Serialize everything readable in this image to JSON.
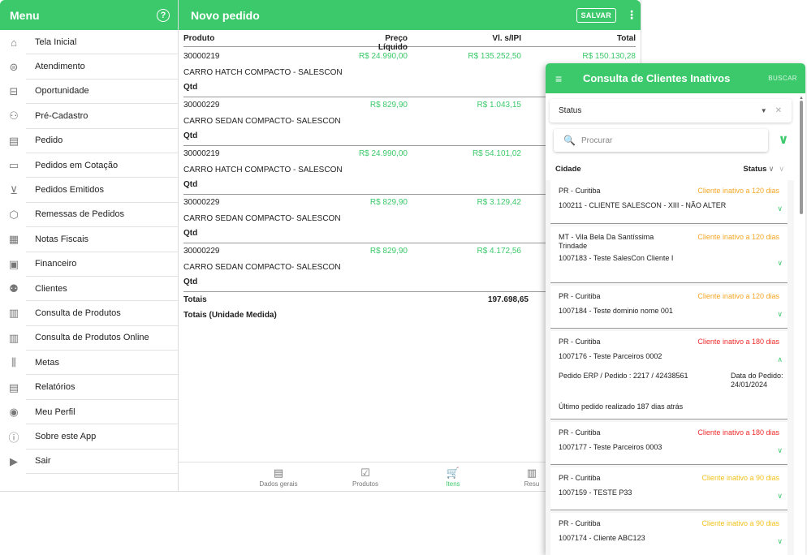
{
  "menu": {
    "title": "Menu",
    "help_icon": "?",
    "items": [
      {
        "label": "Tela Inicial",
        "icon": "⌂",
        "icon_name": "home-icon",
        "slug": "tela-inicial"
      },
      {
        "label": "Atendimento",
        "icon": "⊜",
        "icon_name": "chat-icon",
        "slug": "atendimento"
      },
      {
        "label": "Oportunidade",
        "icon": "⊟",
        "icon_name": "briefcase-icon",
        "slug": "oportunidade"
      },
      {
        "label": "Pré-Cadastro",
        "icon": "⚇",
        "icon_name": "add-user-icon",
        "slug": "pre-cadastro"
      },
      {
        "label": "Pedido",
        "icon": "▤",
        "icon_name": "document-icon",
        "slug": "pedido"
      },
      {
        "label": "Pedidos em Cotação",
        "icon": "▭",
        "icon_name": "quote-icon",
        "slug": "pedidos-em-cotacao"
      },
      {
        "label": "Pedidos Emitidos",
        "icon": "⊻",
        "icon_name": "inbox-icon",
        "slug": "pedidos-emitidos"
      },
      {
        "label": "Remessas de Pedidos",
        "icon": "⬡",
        "icon_name": "box-icon",
        "slug": "remessas-de-pedidos"
      },
      {
        "label": "Notas Fiscais",
        "icon": "▦",
        "icon_name": "invoice-icon",
        "slug": "notas-fiscais"
      },
      {
        "label": "Financeiro",
        "icon": "▣",
        "icon_name": "money-icon",
        "slug": "financeiro"
      },
      {
        "label": "Clientes",
        "icon": "⚉",
        "icon_name": "users-icon",
        "slug": "clientes"
      },
      {
        "label": "Consulta de Produtos",
        "icon": "▥",
        "icon_name": "products-icon",
        "slug": "consulta-de-produtos"
      },
      {
        "label": "Consulta de Produtos Online",
        "icon": "▥",
        "icon_name": "products-online-icon",
        "slug": "consulta-de-produtos-online"
      },
      {
        "label": "Metas",
        "icon": "⫼",
        "icon_name": "bar-chart-icon",
        "slug": "metas"
      },
      {
        "label": "Relatórios",
        "icon": "▤",
        "icon_name": "report-icon",
        "slug": "relatorios"
      },
      {
        "label": "Meu Perfil",
        "icon": "◉",
        "icon_name": "profile-icon",
        "slug": "meu-perfil"
      },
      {
        "label": "Sobre este App",
        "icon": "ⓘ",
        "icon_name": "info-icon",
        "slug": "sobre-este-app"
      },
      {
        "label": "Sair",
        "icon": "▶",
        "icon_name": "logout-icon",
        "slug": "sair"
      }
    ]
  },
  "order": {
    "title": "Novo pedido",
    "save_label": "SALVAR",
    "more_icon": "⋮",
    "columns": {
      "product": "Produto",
      "price": "Preço Líquido",
      "ipi": "Vl. s/IPI",
      "total": "Total"
    },
    "rows": [
      {
        "code": "30000219",
        "price": "R$ 24.990,00",
        "ipi": "R$ 135.252,50",
        "total": "R$ 150.130,28",
        "name": "CARRO HATCH COMPACTO - SALESCON",
        "qty_label": "Qtd"
      },
      {
        "code": "30000229",
        "price": "R$ 829,90",
        "ipi": "R$ 1.043,15",
        "total": "",
        "name": "CARRO SEDAN COMPACTO- SALESCON",
        "qty_label": "Qtd"
      },
      {
        "code": "30000219",
        "price": "R$ 24.990,00",
        "ipi": "R$ 54.101,02",
        "total": "",
        "name": "CARRO HATCH COMPACTO - SALESCON",
        "qty_label": "Qtd"
      },
      {
        "code": "30000229",
        "price": "R$ 829,90",
        "ipi": "R$ 3.129,42",
        "total": "",
        "name": "CARRO SEDAN COMPACTO- SALESCON",
        "qty_label": "Qtd"
      },
      {
        "code": "30000229",
        "price": "R$ 829,90",
        "ipi": "R$ 4.172,56",
        "total": "",
        "name": "CARRO SEDAN COMPACTO- SALESCON",
        "qty_label": "Qtd"
      }
    ],
    "totals_label": "Totais",
    "totals_value": "197.698,65",
    "totals_unit_label": "Totais (Unidade Medida)",
    "tabs": [
      {
        "label": "Dados gerais",
        "icon": "▤",
        "icon_name": "document-icon"
      },
      {
        "label": "Produtos",
        "icon": "☑",
        "icon_name": "checkbox-icon"
      },
      {
        "label": "Itens",
        "icon": "🛒",
        "icon_name": "cart-icon"
      },
      {
        "label": "Resu",
        "icon": "▥",
        "icon_name": "summary-icon"
      }
    ]
  },
  "clients": {
    "title": "Consulta de Clientes Inativos",
    "menu_icon": "≡",
    "search_button": "BUSCAR",
    "status_filter": {
      "label": "Status",
      "caret": "▼",
      "clear": "✕"
    },
    "search": {
      "placeholder": "Procurar",
      "value": "",
      "icon": "🔍"
    },
    "expand_icon": "∨",
    "list_head": {
      "city": "Cidade",
      "status": "Status",
      "caret": "∨",
      "caret2": "∨"
    },
    "colors": {
      "orange": "#f5a623",
      "red": "#ef2a2a",
      "yellow": "#f2c21b",
      "accent": "#3cc96b"
    },
    "items": [
      {
        "city": "PR - Curitiba",
        "status": "Cliente inativo a 120 dias",
        "name": "100211 - CLIENTE SALESCON - XIII - NÃO ALTER",
        "chevron": "∨"
      },
      {
        "city": "MT - Vila Bela Da Santíssima Trindade",
        "status": "Cliente inativo a 120 dias",
        "name": "1007183 - Teste SalesCon Cliente I",
        "chevron": "∨"
      },
      {
        "city": "PR - Curitiba",
        "status": "Cliente inativo a 120 dias",
        "name": "1007184 - Teste dominio nome 001",
        "chevron": "∨"
      },
      {
        "city": "PR - Curitiba",
        "status": "Cliente inativo a 180 dias",
        "name": "1007176 - Teste Parceiros 0002",
        "chevron": "∧",
        "order_info": "Pedido ERP / Pedido : 2217 / 42438561",
        "order_date_label": "Data do Pedido:",
        "order_date": "24/01/2024",
        "last_order": "Último pedido realizado 187 dias atrás"
      },
      {
        "city": "PR - Curitiba",
        "status": "Cliente inativo a 180 dias",
        "name": "1007177 - Teste Parceiros 0003",
        "chevron": "∨"
      },
      {
        "city": "PR - Curitiba",
        "status": "Cliente inativo a 90 dias",
        "name": "1007159 - TESTE P33",
        "chevron": "∨"
      },
      {
        "city": "PR - Curitiba",
        "status": "Cliente inativo a 90 dias",
        "name": "1007174 - Cliente ABC123",
        "chevron": "∨"
      }
    ]
  }
}
